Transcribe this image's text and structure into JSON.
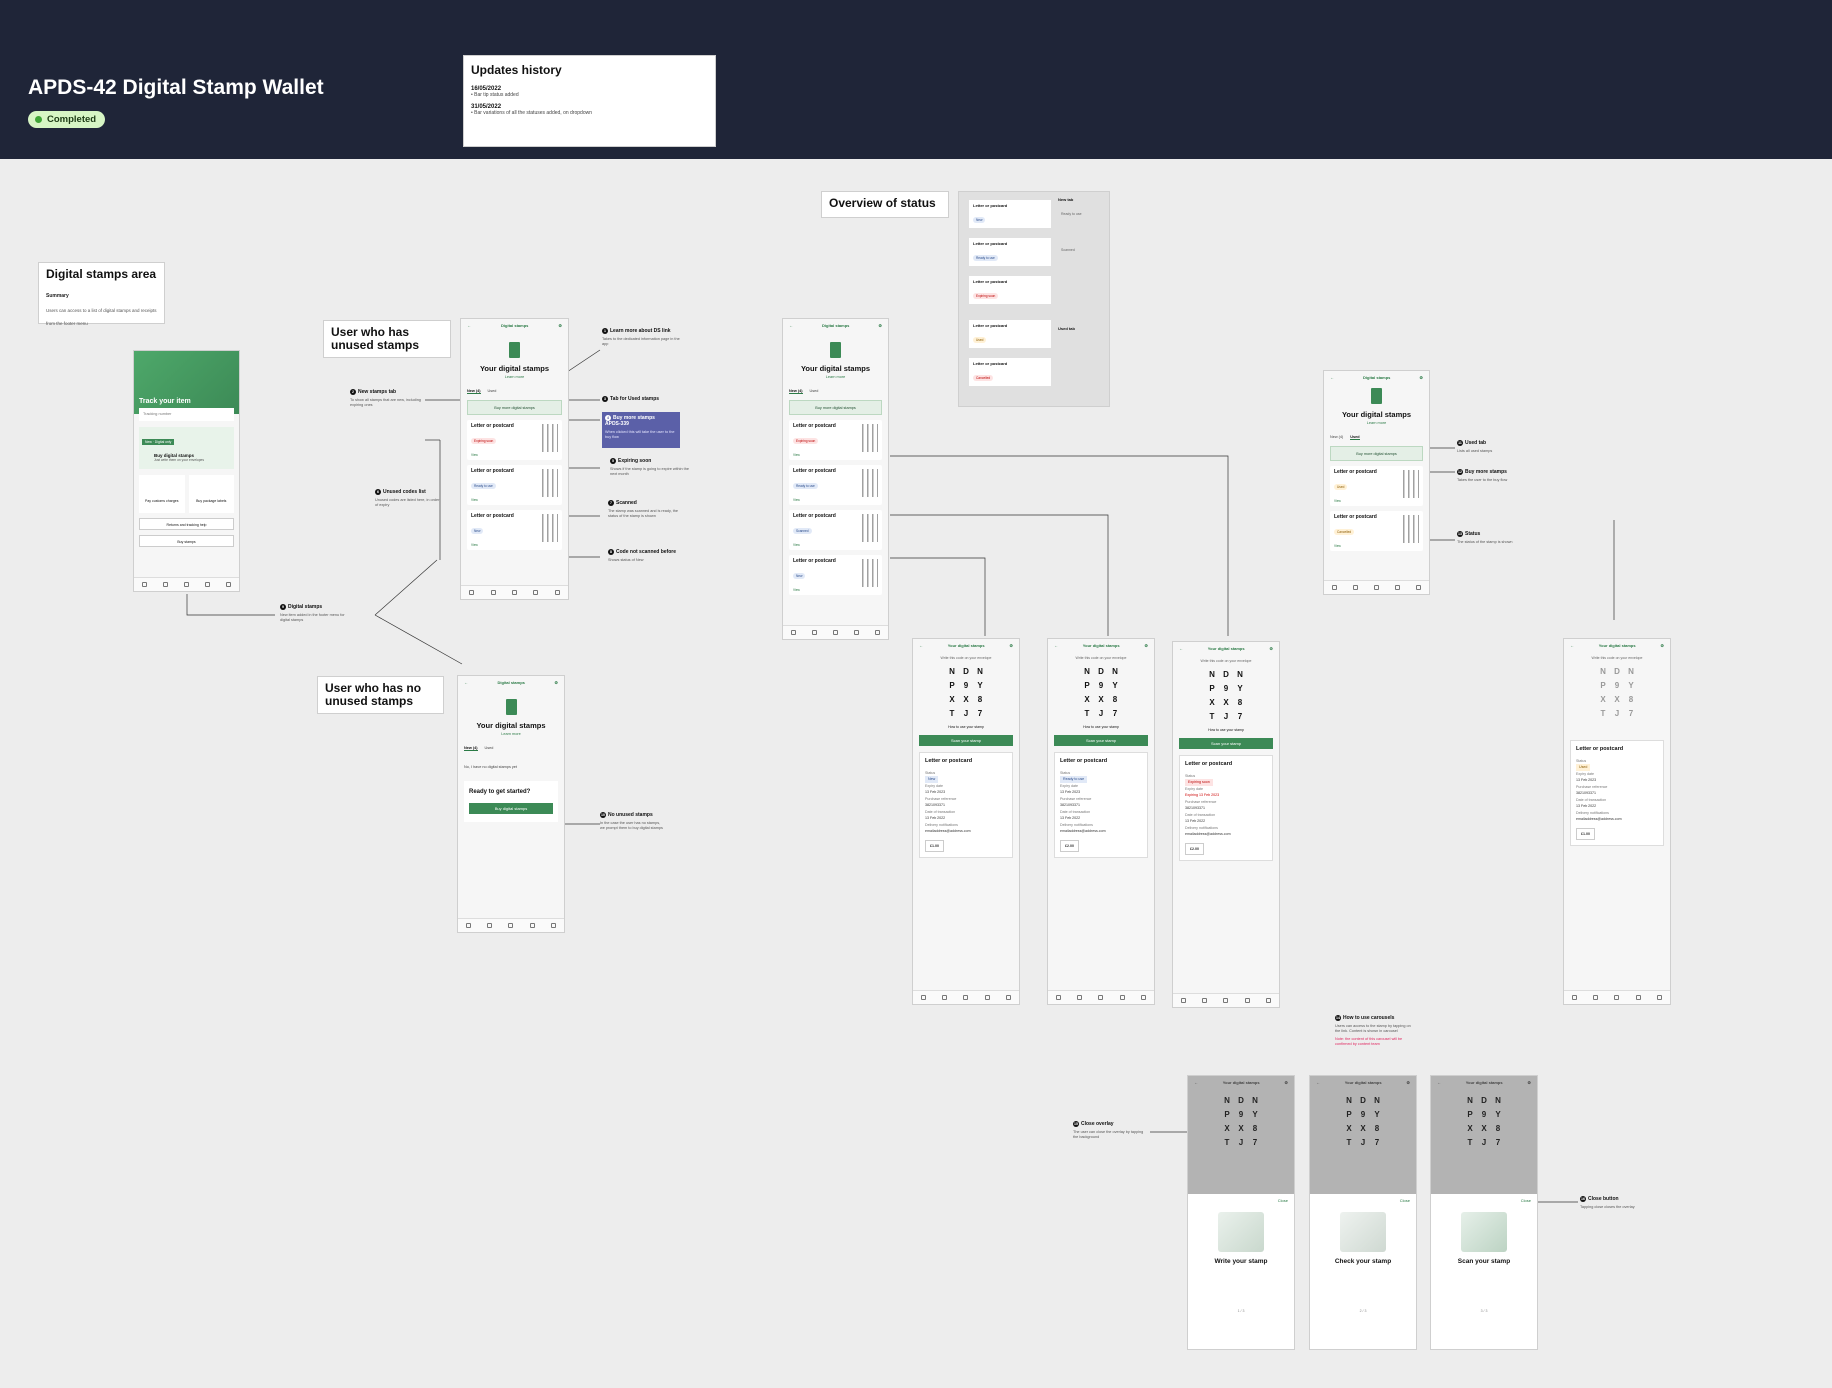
{
  "header": {
    "title": "APDS-42 Digital Stamp Wallet",
    "badge": "Completed"
  },
  "updates": {
    "title": "Updates history",
    "entries": [
      {
        "date": "16/05/2022",
        "text": "• Bar tip status added"
      },
      {
        "date": "31/05/2022",
        "text": "• Bar variations of all the statuses added, on dropdown"
      }
    ]
  },
  "labels": {
    "area_title": "Digital stamps area",
    "area_summary_h": "Summary",
    "area_summary": "Users can access to a list of digital stamps and receipts from the footer menu",
    "unused": "User who has unused stamps",
    "no_unused": "User who has no unused stamps",
    "overview": "Overview of status"
  },
  "track": {
    "title": "Track your item",
    "input": "Tracking number",
    "new": "New · Digital only",
    "buy_title": "Buy digital stamps",
    "buy_sub": "Just write them on your envelopes",
    "tile1": "Pay customs charges",
    "tile2": "Buy package labels",
    "link1": "Returns and tracking help",
    "link2": "Buy stamps"
  },
  "phone": {
    "header": "Digital stamps",
    "title": "Your digital stamps",
    "learn": "Learn more",
    "tab_new": "New (4)",
    "tab_used": "Used",
    "buy_more": "Buy more digital stamps",
    "card_title": "Letter or postcard",
    "view": "View",
    "no_stamps": "No, I have no digital stamps yet",
    "ready": "Ready to get started?",
    "buy_btn": "Buy digital stamps"
  },
  "tags": {
    "expiring": "Expiring soon",
    "ready": "Ready to use",
    "new": "New",
    "scanned": "Scanned",
    "cancelled": "Cancelled",
    "used": "Used"
  },
  "detail": {
    "header": "Your digital stamps",
    "sub": "Write this code on your envelope",
    "letters": [
      "N",
      "D",
      "N",
      "P",
      "9",
      "Y",
      "X",
      "X",
      "8",
      "T",
      "J",
      "7"
    ],
    "how": "How to use your stamp",
    "btn": "Scan your stamp",
    "card_title": "Letter or postcard",
    "k_status": "Status",
    "k_expiry": "Expiry date",
    "v_expiry": "13 Feb 2023",
    "k_ref": "Purchase reference",
    "v_ref": "3821093371",
    "k_date": "Date of transaction",
    "v_date": "13 Feb 2022",
    "k_notif": "Delivery notifications",
    "v_email": "emailaddress@address.com",
    "price": "£1.00",
    "price2": "£2.00",
    "expiring_note": "Expiring 13 Feb 2023"
  },
  "annotations": {
    "a1": {
      "t": "Learn more about DS link",
      "d": "Takes to the dedicated information page in the app"
    },
    "a2": {
      "t": "New stamps tab",
      "d": "To show all stamps that are new, including expiring ones"
    },
    "a3": {
      "t": "Tab for Used stamps"
    },
    "a4": {
      "t": "Buy more stamps",
      "t2": "APDS-339",
      "d": "When clicked this will take the user to the buy flow"
    },
    "a5": {
      "t": "Expiring soon",
      "d": "Shows if the stamp is going to expire within the next month"
    },
    "a6": {
      "t": "Unused codes list",
      "d": "Unused codes are listed here, in order of expiry"
    },
    "a7": {
      "t": "Scanned",
      "d": "The stamp was scanned and is ready, the status of the stamp is shown"
    },
    "a8": {
      "t": "Code not scanned before",
      "d": "Shows status of New"
    },
    "a9": {
      "t": "Digital stamps",
      "d": "New item added in the footer menu for digital stamps"
    },
    "a10": {
      "t": "No unused stamps",
      "d": "In the case the user has no stamps, we prompt them to buy digital stamps"
    },
    "a11": {
      "t": "Used tab",
      "d": "Lists all used stamps"
    },
    "a12": {
      "t": "Buy more stamps",
      "d": "Takes the user to the buy flow"
    },
    "a13": {
      "t": "Status",
      "d": "The status of the stamp is shown"
    },
    "a14": {
      "t": "How to use carousels",
      "d": "Users can access to the stamp by tapping on the link. Content is shown in carousel",
      "warn": "Note: the content of this carousel will be confirmed by content team"
    },
    "a15": {
      "t": "Close overlay",
      "d": "The user can close the overlay by tapping the background"
    },
    "a16": {
      "t": "Close button",
      "d": "Tapping close closes the overlay"
    }
  },
  "status_legend": {
    "new_tab": "New tab",
    "used_tab": "Used tab",
    "label1": "Ready to use",
    "label2": "Scanned"
  },
  "carousel": {
    "close": "Close",
    "s1": "Write your stamp",
    "s2": "Check your stamp",
    "s3": "Scan your stamp",
    "pager1": "1 / 3",
    "pager2": "2 / 3",
    "pager3": "3 / 3"
  },
  "colors": {
    "header_bg": "#1f2538",
    "brand_green": "#3c8a56",
    "badge_bg": "#d6f5c4",
    "highlight": "#5b60a8"
  }
}
